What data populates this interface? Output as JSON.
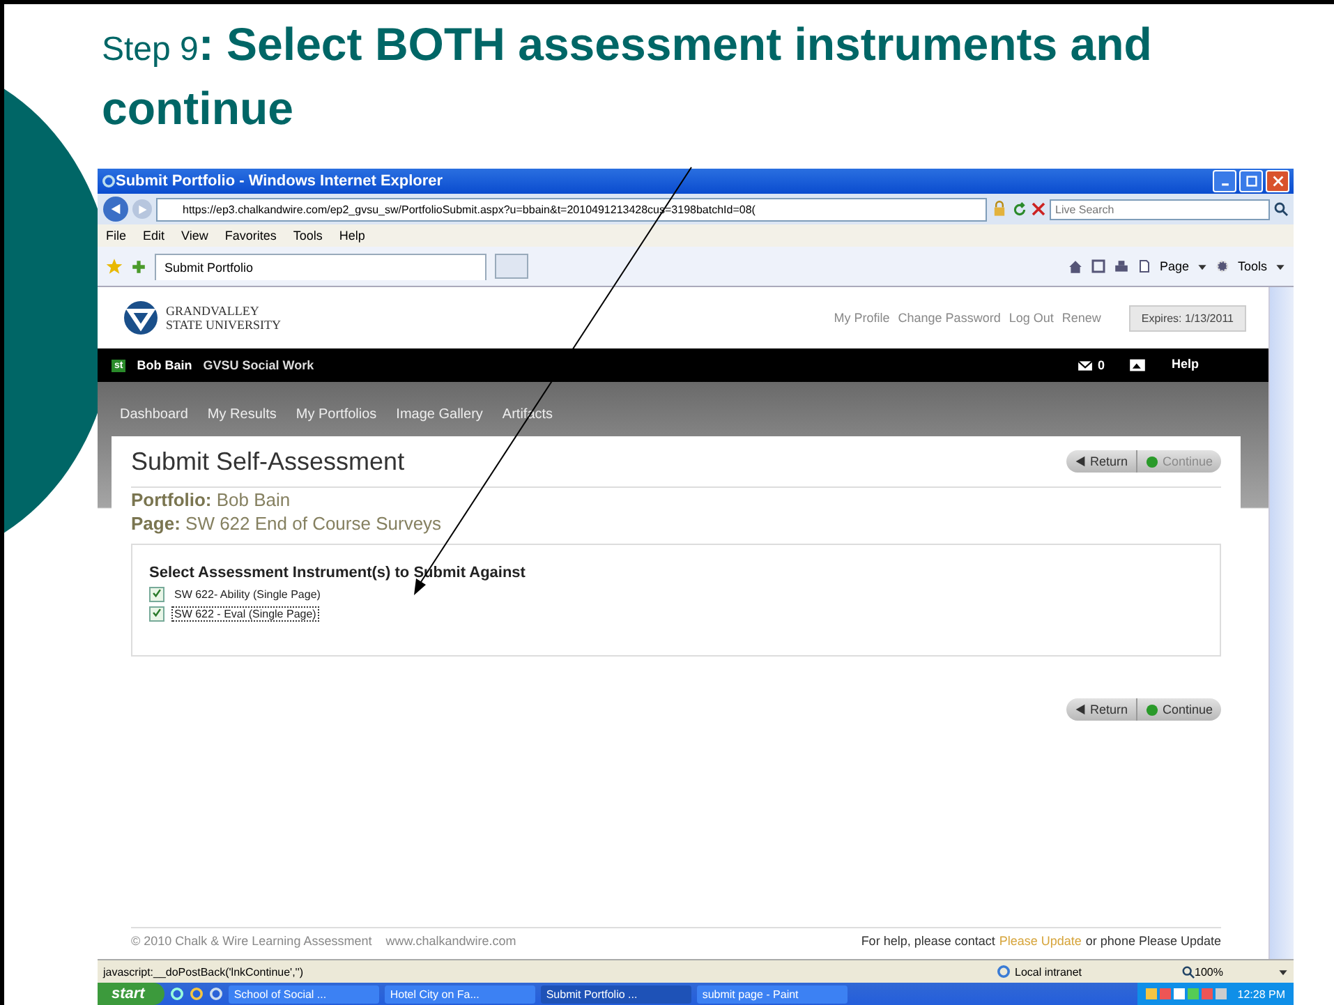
{
  "slide": {
    "title": "Step 9**: Select BOTH assessment instruments and continue**"
  },
  "browser": {
    "title": "Submit Portfolio - Windows Internet Explorer",
    "address": "https://ep3.chalkandwire.com/ep2_gvsu_sw/PortfolioSubmit.aspx?u=bbain&t=2010491213428cus=3198batchId=08(",
    "search_placeholder": "Live Search",
    "menu": [
      "File",
      "Edit",
      "View",
      "Favorites",
      "Tools",
      "Help"
    ],
    "tab": "Submit Portfolio",
    "commands": [
      "Page",
      "Tools"
    ]
  },
  "site": {
    "logo_lines": [
      "GRANDVALLEY",
      "STATE UNIVERSITY"
    ],
    "top_links": [
      "My Profile",
      "Change Password",
      "Log Out",
      "Renew"
    ],
    "expires": "Expires: 1/13/2011",
    "user_badge": "st",
    "user": "Bob Bain",
    "org": "GVSU Social Work",
    "messages": "0",
    "help": "Help",
    "nav": [
      "Dashboard",
      "My Results",
      "My Portfolios",
      "Image Gallery",
      "Artifacts"
    ],
    "page_title": "Submit Self-Assessment",
    "top_buttons": [
      {
        "label": "Return",
        "kind": "return",
        "disabled": false
      },
      {
        "label": "Continue",
        "kind": "continue",
        "disabled": true
      }
    ],
    "portfolio_label": "Portfolio:",
    "portfolio": "Bob Bain",
    "page_label": "Page:",
    "page": "SW 622 End of Course Surveys",
    "section_heading": "Select Assessment Instrument(s) to Submit Against",
    "instruments": [
      {
        "label": "SW 622- Ability (Single Page)",
        "checked": true,
        "focused": false
      },
      {
        "label": "SW 622 - Eval (Single Page)",
        "checked": true,
        "focused": true
      }
    ],
    "bottom_buttons": [
      {
        "label": "Return",
        "kind": "return",
        "disabled": false
      },
      {
        "label": "Continue",
        "kind": "continue",
        "disabled": false
      }
    ],
    "copyright": "© 2010 Chalk & Wire Learning Assessment",
    "website": "www.chalkandwire.com",
    "help_before": "For help, please contact",
    "help_link": "Please Update",
    "help_after": "or phone Please Update"
  },
  "status_bar": {
    "text": "javascript:__doPostBack('lnkContinue','')",
    "zone": "Local intranet",
    "zoom": "100%"
  },
  "taskbar": {
    "start": "start",
    "tasks": [
      {
        "label": "School of Social ...",
        "selected": false
      },
      {
        "label": "Hotel City on Fa...",
        "selected": false
      },
      {
        "label": "Submit Portfolio ...",
        "selected": true
      },
      {
        "label": "submit page - Paint",
        "selected": false
      }
    ],
    "clock": "12:28 PM"
  }
}
